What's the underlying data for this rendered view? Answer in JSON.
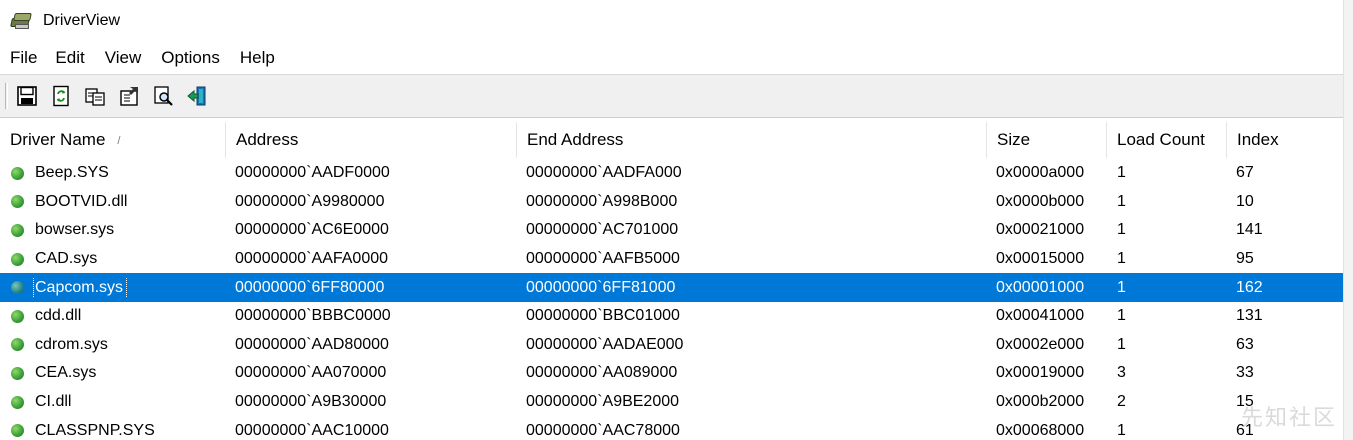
{
  "window": {
    "title": "DriverView"
  },
  "menu": [
    "File",
    "Edit",
    "View",
    "Options",
    "Help"
  ],
  "toolbar": [
    "save-icon",
    "refresh-icon",
    "copy-icon",
    "properties-icon",
    "find-icon",
    "exit-icon"
  ],
  "columns": {
    "name": "Driver Name",
    "address": "Address",
    "end_address": "End Address",
    "size": "Size",
    "load_count": "Load Count",
    "index": "Index"
  },
  "sort_indicator": "/",
  "rows": [
    {
      "name": "Beep.SYS",
      "address": "00000000`AADF0000",
      "end_address": "00000000`AADFA000",
      "size": "0x0000a000",
      "load_count": "1",
      "index": "67"
    },
    {
      "name": "BOOTVID.dll",
      "address": "00000000`A9980000",
      "end_address": "00000000`A998B000",
      "size": "0x0000b000",
      "load_count": "1",
      "index": "10"
    },
    {
      "name": "bowser.sys",
      "address": "00000000`AC6E0000",
      "end_address": "00000000`AC701000",
      "size": "0x00021000",
      "load_count": "1",
      "index": "141"
    },
    {
      "name": "CAD.sys",
      "address": "00000000`AAFA0000",
      "end_address": "00000000`AAFB5000",
      "size": "0x00015000",
      "load_count": "1",
      "index": "95"
    },
    {
      "name": "Capcom.sys",
      "address": "00000000`6FF80000",
      "end_address": "00000000`6FF81000",
      "size": "0x00001000",
      "load_count": "1",
      "index": "162",
      "selected": true
    },
    {
      "name": "cdd.dll",
      "address": "00000000`BBBC0000",
      "end_address": "00000000`BBC01000",
      "size": "0x00041000",
      "load_count": "1",
      "index": "131"
    },
    {
      "name": "cdrom.sys",
      "address": "00000000`AAD80000",
      "end_address": "00000000`AADAE000",
      "size": "0x0002e000",
      "load_count": "1",
      "index": "63"
    },
    {
      "name": "CEA.sys",
      "address": "00000000`AA070000",
      "end_address": "00000000`AA089000",
      "size": "0x00019000",
      "load_count": "3",
      "index": "33"
    },
    {
      "name": "CI.dll",
      "address": "00000000`A9B30000",
      "end_address": "00000000`A9BE2000",
      "size": "0x000b2000",
      "load_count": "2",
      "index": "15"
    },
    {
      "name": "CLASSPNP.SYS",
      "address": "00000000`AAC10000",
      "end_address": "00000000`AAC78000",
      "size": "0x00068000",
      "load_count": "1",
      "index": "61"
    }
  ],
  "colors": {
    "selection": "#0078d7",
    "toolbar_bg": "#f0f0f0"
  },
  "watermark": "先知社区"
}
